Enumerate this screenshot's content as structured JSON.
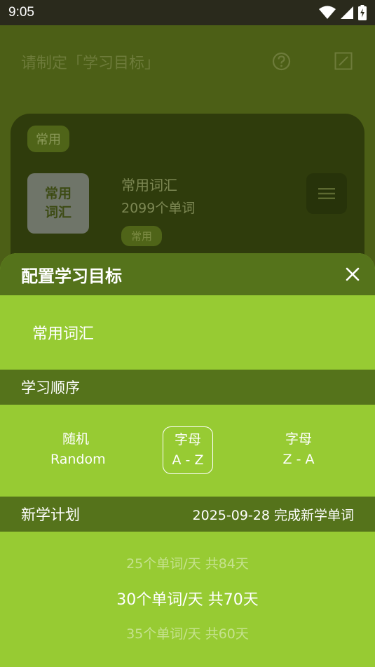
{
  "status_bar": {
    "time": "9:05",
    "icons": [
      "wifi-icon",
      "signal-icon",
      "battery-charging-icon"
    ]
  },
  "background_page": {
    "title": "请制定「学习目标」",
    "icons": [
      "help-circle-icon",
      "edit-square-icon"
    ],
    "card": {
      "tag": "常用",
      "cover_text": "常用\n词汇",
      "book_name": "常用词汇",
      "word_count": "2099个单词",
      "book_tag": "常用"
    }
  },
  "sheet": {
    "title": "配置学习目标",
    "selected_book": "常用词汇",
    "order_section": {
      "label": "学习顺序",
      "options": [
        {
          "line1": "随机",
          "line2": "Random",
          "selected": false
        },
        {
          "line1": "字母",
          "line2": "A - Z",
          "selected": true
        },
        {
          "line1": "字母",
          "line2": "Z - A",
          "selected": false
        }
      ]
    },
    "plan_section": {
      "label": "新学计划",
      "completion": "2025-09-28 完成新学单词",
      "picker": [
        {
          "text": "25个单词/天  共84天",
          "state": "faded"
        },
        {
          "text": "30个单词/天  共70天",
          "state": "current"
        },
        {
          "text": "35个单词/天  共60天",
          "state": "faded"
        }
      ]
    }
  },
  "colors": {
    "accent_green": "#97CB33",
    "header_green": "#55731B",
    "dim_background": "#4C5F16",
    "white": "#FFFFFF"
  }
}
